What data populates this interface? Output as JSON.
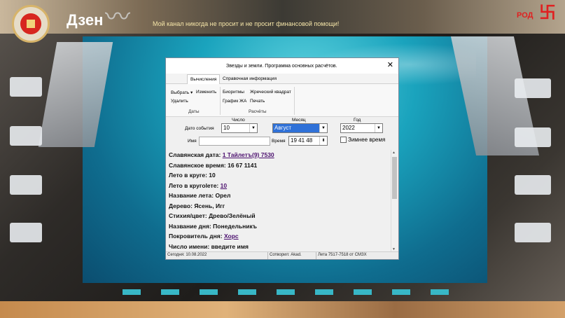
{
  "overlay": {
    "channel_name": "Дзен",
    "tagline": "Мой канал никогда не просит и не просит финансовой помощи!",
    "corner_badge": "РОД"
  },
  "window": {
    "title": "Звезды и земли. Программа основных расчётов.",
    "close_label": "✕",
    "tabs": [
      "Вычисления",
      "Справочная информация"
    ],
    "ribbon": {
      "dates_group": {
        "select_label": "Выбрать",
        "edit_label": "Изменить",
        "delete_label": "Удалить",
        "group_label": "Даты"
      },
      "calc_group": {
        "biorhythms_label": "Биоритмы",
        "priest_square_label": "Жреческий квадрат",
        "zha_chart_label": "График ЖА",
        "print_label": "Печать",
        "group_label": "Расчёты"
      }
    },
    "form": {
      "event_date_label": "Дато события",
      "day_header": "Число",
      "day_value": "10",
      "month_header": "Месяц",
      "month_value": "Август",
      "year_header": "Год",
      "year_value": "2022",
      "name_label": "Имя",
      "name_value": "",
      "time_label": "Время",
      "time_value": "19 41 48",
      "winter_time_label": "Зимнее время",
      "winter_time_checked": false
    },
    "info_lines": [
      {
        "label": "Славянская дата: ",
        "value": "1 Тайлетъ(9) 7530",
        "link": true
      },
      {
        "label": "Славянское время: ",
        "value": "16 67 1141",
        "link": false
      },
      {
        "label": "Лето в круге: ",
        "value": "10",
        "link": false
      },
      {
        "label": "Лето в кругolете: ",
        "value": "10",
        "link": true
      },
      {
        "label": "Название лета: ",
        "value": "Орел",
        "link": false
      },
      {
        "label": "Дерево: ",
        "value": "Ясень, Игг",
        "link": false
      },
      {
        "label": "Стихия/цвет: ",
        "value": "Древо/Зелёный",
        "link": false
      },
      {
        "label": "Название дня: ",
        "value": "Понедельникъ",
        "link": false
      },
      {
        "label": "Покровитель дня: ",
        "value": "Хорс",
        "link": true
      },
      {
        "label": "Число имени: ",
        "value": " введите имя",
        "link": false
      }
    ],
    "status": {
      "today": "Сегодня: 10.08.2022",
      "author": "Сотворил: Akad.",
      "years": "Лета 7517-7518 от СМЗХ"
    }
  },
  "icons": [
    "logo-emblem-icon",
    "seagull-icon",
    "swastika-mark-icon",
    "close-icon",
    "chevron-down-icon"
  ]
}
